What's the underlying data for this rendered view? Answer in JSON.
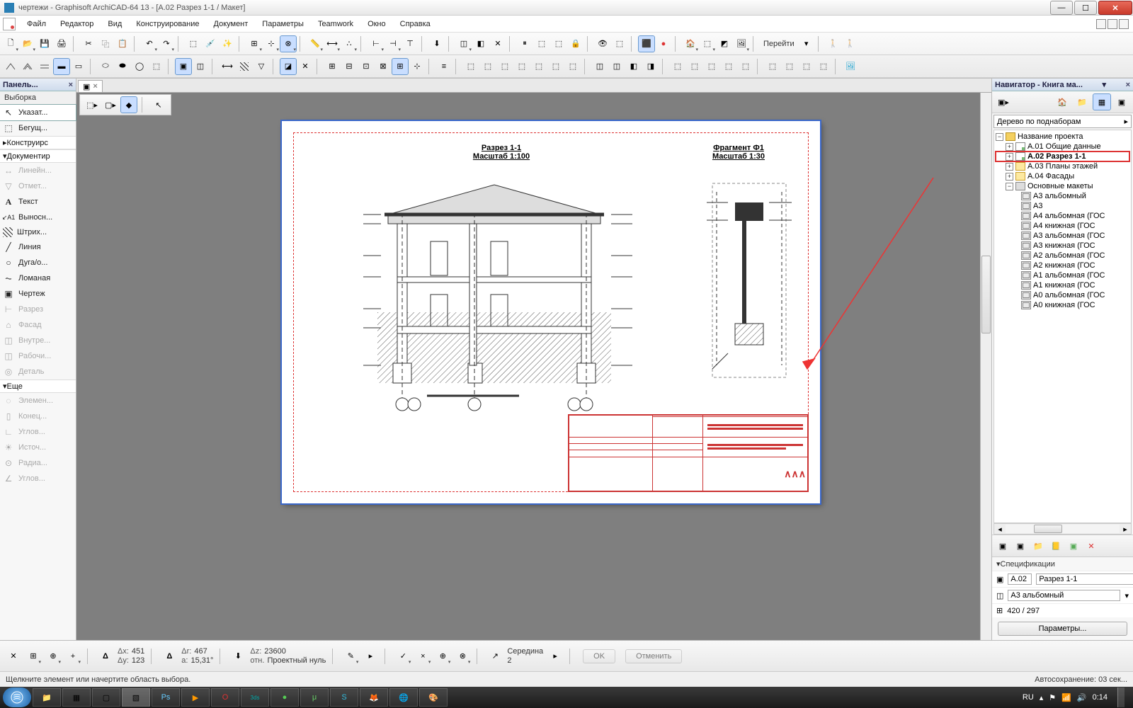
{
  "title": "чертежи - Graphisoft ArchiCAD-64 13 - [A.02 Разрез 1-1 / Макет]",
  "menu": [
    "Файл",
    "Редактор",
    "Вид",
    "Конструирование",
    "Документ",
    "Параметры",
    "Teamwork",
    "Окно",
    "Справка"
  ],
  "goto_label": "Перейти",
  "left_panel": {
    "title": "Панель...",
    "selection": "Выборка",
    "arrow": "Указат...",
    "marquee": "Бегущ...",
    "group_construct": "Конструирс",
    "group_document": "Документир",
    "items_doc": [
      "Линейн...",
      "Отмет...",
      "Текст",
      "Выносн...",
      "Штрих...",
      "Линия",
      "Дуга/о...",
      "Ломаная",
      "Чертеж",
      "Разрез",
      "Фасад",
      "Внутре...",
      "Рабочи...",
      "Деталь"
    ],
    "group_more": "Еще",
    "items_more": [
      "Элемен...",
      "Конец...",
      "Углов...",
      "Источ...",
      "Радиа...",
      "Углов..."
    ]
  },
  "doc_tab": {
    "close": "×"
  },
  "drawing": {
    "title1": "Разрез 1-1",
    "scale1": "Масштаб 1:100",
    "title2": "Фрагмент Ф1",
    "scale2": "Масштаб 1:30"
  },
  "navigator": {
    "title": "Навигатор - Книга ма...",
    "combo": "Дерево по поднаборам",
    "tree": {
      "root": "Название проекта",
      "l1": "A.01 Общие данные",
      "l2": "A.02 Разрез 1-1",
      "l3": "A.03 Планы этажей",
      "l4": "A.04 Фасады",
      "masters_group": "Основные макеты",
      "masters": [
        "A3 альбомный",
        "A3",
        "A4 альбомная (ГОС",
        "A4 книжная (ГОС",
        "A3 альбомная (ГОС",
        "A3 книжная (ГОС",
        "A2 альбомная (ГОС",
        "A2 книжная (ГОС",
        "A1 альбомная (ГОС",
        "A1 книжная (ГОС",
        "A0 альбомная (ГОС",
        "A0 книжная (ГОС"
      ]
    },
    "spec_label": "Спецификации",
    "code": "A.02",
    "name": "Разрез 1-1",
    "master": "A3 альбомный",
    "size": "420 / 297",
    "params_btn": "Параметры..."
  },
  "coords": {
    "dx_lbl": "Δx:",
    "dx": "451",
    "dy_lbl": "Δy:",
    "dy": "123",
    "dr_lbl": "Δr:",
    "dr": "467",
    "da_lbl": "a:",
    "da": "15,31°",
    "dz_lbl": "Δz:",
    "dz": "23600",
    "ref_lbl": "отн.",
    "ref": "Проектный нуль",
    "mid": "Середина",
    "mid_n": "2",
    "ok": "OK",
    "cancel": "Отменить"
  },
  "status": {
    "hint": "Щелкните элемент или начертите область выбора.",
    "autosave": "Автосохранение: 03 сек..."
  },
  "taskbar": {
    "lang": "RU",
    "time": "0:14"
  }
}
